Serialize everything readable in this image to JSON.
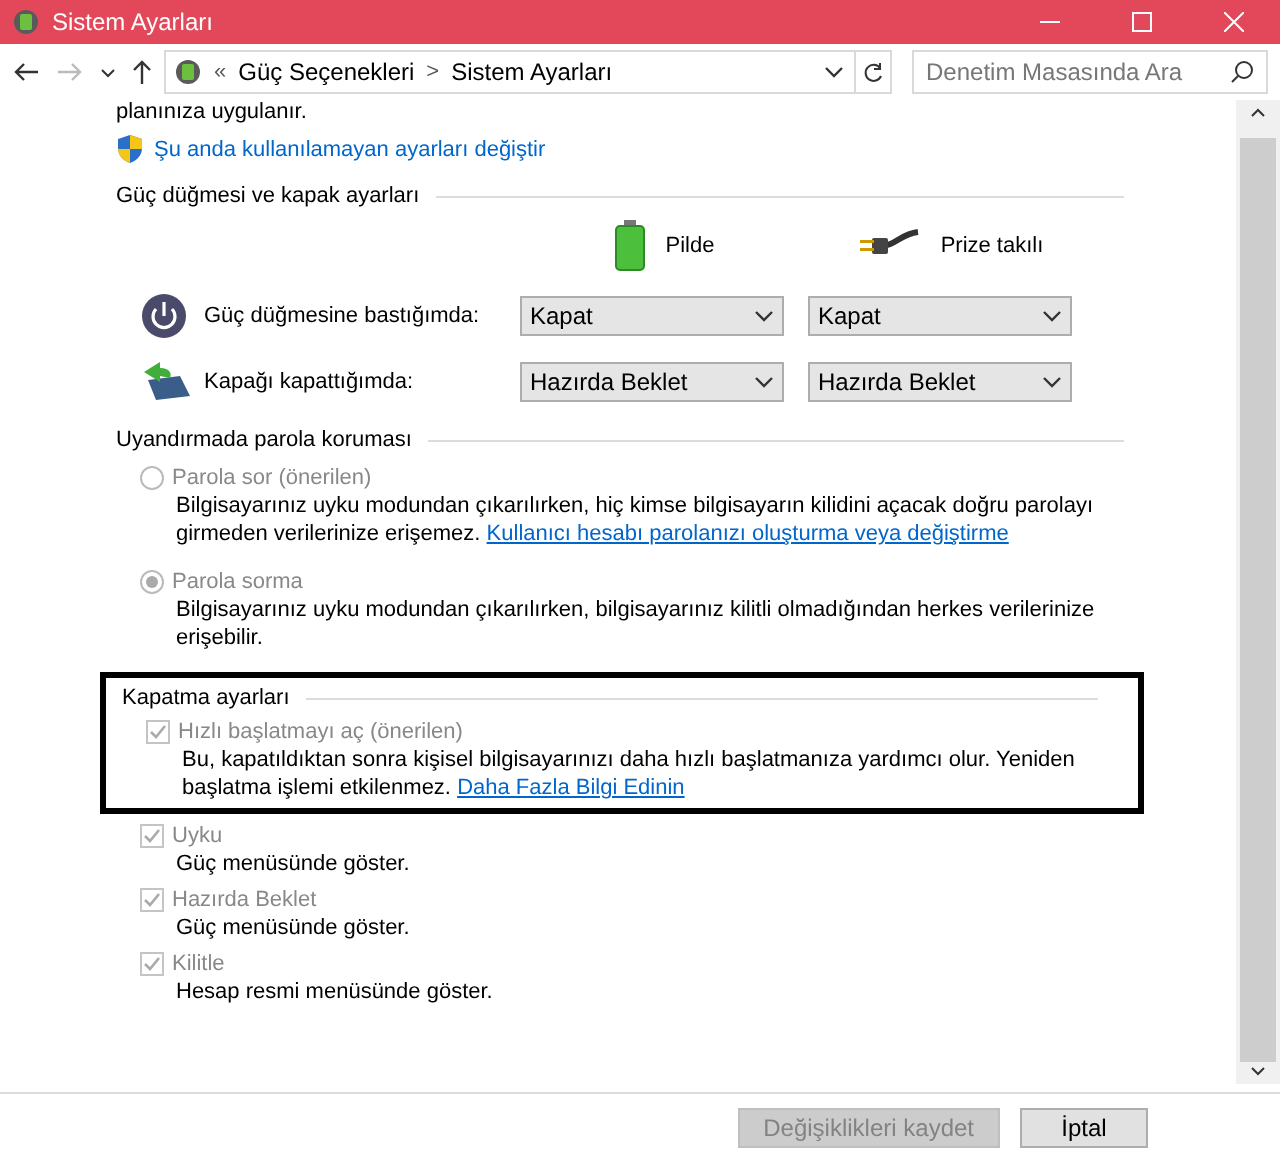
{
  "window": {
    "title": "Sistem Ayarları"
  },
  "address_bar": {
    "overflow": "«",
    "crumbs": [
      "Güç Seçenekleri",
      "Sistem Ayarları"
    ],
    "separator": ">"
  },
  "search": {
    "placeholder": "Denetim Masasında Ara"
  },
  "intro_text": "planınıza uygulanır.",
  "admin_link": "Şu anda kullanılamayan ayarları değiştir",
  "power_section": {
    "heading": "Güç düğmesi ve kapak ayarları",
    "columns": [
      {
        "kind": "battery",
        "label": "Pilde"
      },
      {
        "kind": "plug",
        "label": "Prize takılı"
      }
    ],
    "rows": [
      {
        "kind": "power",
        "label": "Güç düğmesine bastığımda:",
        "values": [
          "Kapat",
          "Kapat"
        ]
      },
      {
        "kind": "lid",
        "label": "Kapağı kapattığımda:",
        "values": [
          "Hazırda Beklet",
          "Hazırda Beklet"
        ]
      }
    ]
  },
  "password_section": {
    "heading": "Uyandırmada parola koruması",
    "options": [
      {
        "label": "Parola sor (önerilen)",
        "selected": false,
        "disabled": true,
        "description": "Bilgisayarınız uyku modundan çıkarılırken, hiç kimse bilgisayarın kilidini açacak doğru parolayı girmeden verilerinize erişemez.",
        "link": "Kullanıcı hesabı parolanızı oluşturma veya değiştirme"
      },
      {
        "label": "Parola sorma",
        "selected": true,
        "disabled": true,
        "description": "Bilgisayarınız uyku modundan çıkarılırken, bilgisayarınız kilitli olmadığından herkes verilerinize erişebilir."
      }
    ]
  },
  "shutdown_section": {
    "heading": "Kapatma ayarları",
    "highlighted": true,
    "options": [
      {
        "label": "Hızlı başlatmayı aç (önerilen)",
        "checked": true,
        "disabled": true,
        "description": "Bu, kapatıldıktan sonra kişisel bilgisayarınızı daha hızlı başlatmanıza yardımcı olur. Yeniden başlatma işlemi etkilenmez.",
        "link": "Daha Fazla Bilgi Edinin"
      },
      {
        "label": "Uyku",
        "checked": true,
        "disabled": true,
        "description": "Güç menüsünde göster."
      },
      {
        "label": "Hazırda Beklet",
        "checked": true,
        "disabled": true,
        "description": "Güç menüsünde göster."
      },
      {
        "label": "Kilitle",
        "checked": true,
        "disabled": true,
        "description": "Hesap resmi menüsünde göster."
      }
    ]
  },
  "buttons": [
    {
      "label": "Değişiklikleri kaydet",
      "disabled": true
    },
    {
      "label": "İptal",
      "disabled": false
    }
  ]
}
